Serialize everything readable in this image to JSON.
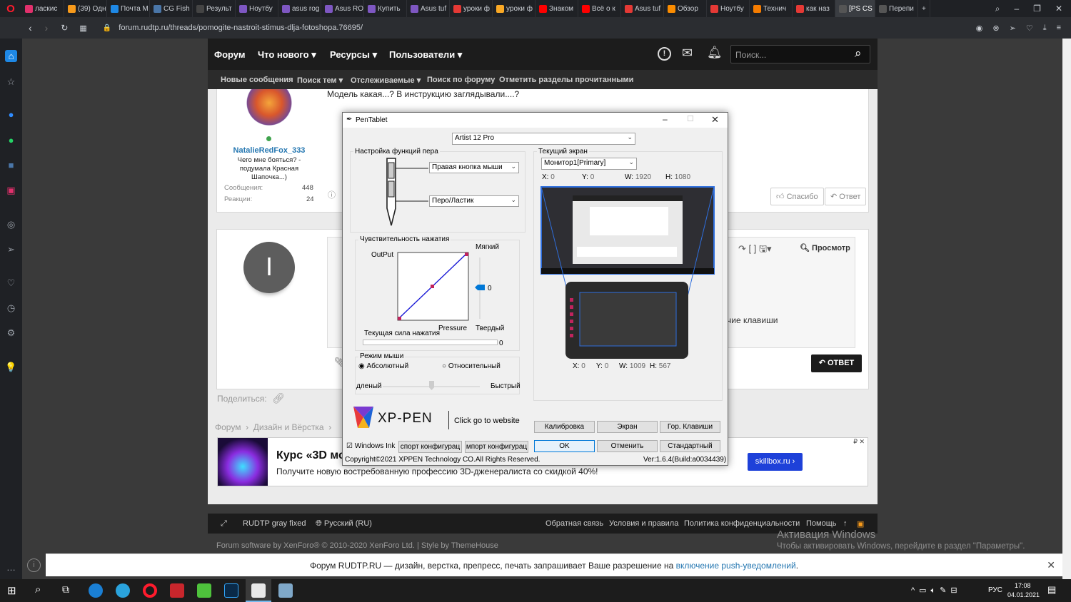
{
  "browser": {
    "tabs": [
      "ласкис",
      "(39) Одн",
      "Почта М",
      "CG Fish",
      "Результ",
      "Ноутбу",
      "asus rog",
      "Asus RO",
      "Купить",
      "Asus tuf",
      "уроки ф",
      "уроки ф",
      "Знаком",
      "Всё о к",
      "Asus tuf",
      "Обзор",
      "Ноутбу",
      "Технич",
      "как наз",
      "[PS CS",
      "Перепи"
    ],
    "url": "forum.rudtp.ru/threads/pomogite-nastroit-stimus-dlja-fotoshopa.76695/"
  },
  "forum": {
    "nav": [
      "Форум",
      "Что нового",
      "Ресурсы",
      "Пользователи"
    ],
    "search_placeholder": "Поиск...",
    "subnav": [
      "Новые сообщения",
      "Поиск тем",
      "Отслеживаемые",
      "Поиск по форуму",
      "Отметить разделы прочитанными"
    ],
    "post_text": "Модель какая...? В инструкцию заглядывали....?",
    "author": {
      "name": "NatalieRedFox_333",
      "title": "Чего мне бояться? - подумала Красная Шапочка...)",
      "messages_label": "Сообщения:",
      "messages": "448",
      "reactions_label": "Реакции:",
      "reactions": "24"
    },
    "like_label": "Спасибо",
    "reply_label": "Ответ",
    "preview_label": "Просмотр",
    "reply_button": "ОТВЕТ",
    "avatar_letter": "I",
    "hint_text": "чие клавиши",
    "share_label": "Поделиться:",
    "breadcrumbs": [
      "Форум",
      "Дизайн и Вёрстка"
    ],
    "ad": {
      "title": "Курс «3D мо",
      "text": "Получите новую востребованную профессию 3D-дженералиста со скидкой 40%!",
      "button": "skillbox.ru ›"
    },
    "footer": {
      "style": "RUDTP gray fixed",
      "lang": "Русский (RU)",
      "links": [
        "Обратная связь",
        "Условия и правила",
        "Политика конфиденциальности",
        "Помощь"
      ],
      "copyright": "Forum software by XenForo® © 2010-2020 XenForo Ltd. | Style by ThemeHouse"
    },
    "activation": {
      "title": "Активация Windows",
      "text": "Чтобы активировать Windows, перейдите в раздел \"Параметры\"."
    },
    "notification": {
      "text": "Форум RUDTP.RU — дизайн, верстка, препресс, печать запрашивает Ваше разрешение на",
      "link": "включение push-уведомлений"
    }
  },
  "dialog": {
    "title": "PenTablet",
    "device": "Artist 12 Pro",
    "pen_group": "Настройка функций пера",
    "pen_btn1": "Правая кнопка мыши",
    "pen_btn2": "Перо/Ластик",
    "pressure_group": "Чувствительность нажатия",
    "output_label": "OutPut",
    "pressure_label": "Pressure",
    "soft_label": "Мягкий",
    "hard_label": "Твердый",
    "slider_value": "0",
    "current_force_label": "Текущая сила нажатия",
    "current_force_value": "0",
    "mouse_group": "Режим мыши",
    "absolute": "Абсолютный",
    "relative": "Относительный",
    "slow": "дленый",
    "fast": "Быстрый",
    "screen_group": "Текущий экран",
    "monitor": "Монитор1[Primary]",
    "screen": {
      "x": "0",
      "y": "0",
      "w": "1920",
      "h": "1080"
    },
    "tablet": {
      "x": "0",
      "y": "0",
      "w": "1009",
      "h": "567"
    },
    "xp_pen": "XP-PEN",
    "click_site": "Click go to website",
    "windows_ink": "Windows Ink",
    "export": "спорт конфигурац",
    "import": "мпорт конфигурац",
    "calibrate": "Калибровка",
    "screen_btn": "Экран",
    "hotkeys": "Гор. Клавиши",
    "ok": "OK",
    "cancel": "Отменить",
    "standard": "Стандартный",
    "copyright": "Copyright©2021  XPPEN Technology CO.All Rights Reserved.",
    "version": "Ver:1.6.4(Build:a0034439)"
  },
  "taskbar": {
    "lang": "РУС",
    "time": "17:08",
    "date": "04.01.2021"
  },
  "colors": {
    "accent": "#0078d7",
    "forum_dark": "#1c1c1c",
    "ad_blue": "#1e41d9"
  }
}
